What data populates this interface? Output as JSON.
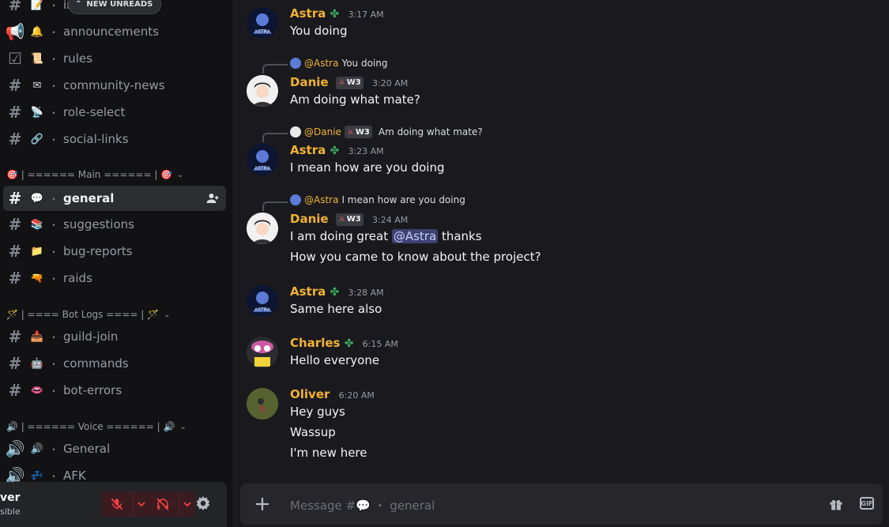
{
  "sidebar": {
    "new_unreads": "NEW UNREADS",
    "channels_top": [
      {
        "label": "in",
        "emoji": "📝"
      },
      {
        "label": "announcements",
        "emoji": "🔔"
      },
      {
        "label": "rules",
        "emoji": "📜"
      },
      {
        "label": "community-news",
        "emoji": "✉"
      },
      {
        "label": "role-select",
        "emoji": "📡"
      },
      {
        "label": "social-links",
        "emoji": "🔗"
      }
    ],
    "cat_main": "🎯 | ====== Main ====== | 🎯",
    "channels_main": [
      {
        "label": "general",
        "emoji": "💬"
      },
      {
        "label": "suggestions",
        "emoji": "📚"
      },
      {
        "label": "bug-reports",
        "emoji": "📁"
      },
      {
        "label": "raids",
        "emoji": "🔫"
      }
    ],
    "cat_logs": "🪄 | ==== Bot Logs ==== | 🪄",
    "channels_logs": [
      {
        "label": "guild-join",
        "emoji": "📥"
      },
      {
        "label": "commands",
        "emoji": "🤖"
      },
      {
        "label": "bot-errors",
        "emoji": "👄"
      }
    ],
    "cat_voice": "🔊 | ====== Voice ====== | 🔊",
    "channels_voice": [
      {
        "label": "General",
        "emoji": "🔊"
      },
      {
        "label": "AFK",
        "emoji": "💤"
      }
    ]
  },
  "user": {
    "name": "ver",
    "status": "sible"
  },
  "messages": [
    {
      "author": "Astra",
      "time": "3:17 AM",
      "lines": [
        "You doing"
      ]
    },
    {
      "reply_to": "@Astra",
      "reply_text": "You doing",
      "author": "Danie",
      "badge": "W3",
      "time": "3:20 AM",
      "lines": [
        "Am doing what mate?"
      ]
    },
    {
      "reply_to": "@Danie",
      "reply_badge": "W3",
      "reply_text": "Am doing what mate?",
      "author": "Astra",
      "time": "3:23 AM",
      "lines": [
        "I mean how are you doing"
      ]
    },
    {
      "reply_to": "@Astra",
      "reply_text": "I mean how are you doing",
      "author": "Danie",
      "badge": "W3",
      "time": "3:24 AM",
      "line1_pre": "I am doing great ",
      "line1_mention": "@Astra",
      "line1_post": " thanks",
      "lines": [
        "How you came to know about the project?"
      ]
    },
    {
      "author": "Astra",
      "time": "3:28 AM",
      "lines": [
        "Same here also"
      ]
    },
    {
      "author": "Charles",
      "time": "6:15 AM",
      "lines": [
        "Hello everyone"
      ]
    },
    {
      "author": "Oliver",
      "time": "6:20 AM",
      "lines": [
        "Hey guys",
        "Wassup",
        "I'm new here"
      ]
    }
  ],
  "composer": {
    "placeholder": "Message #💬 ・ general"
  },
  "colors": {
    "accent_name": "#f0b232",
    "active_channel": "#2b2d31"
  }
}
